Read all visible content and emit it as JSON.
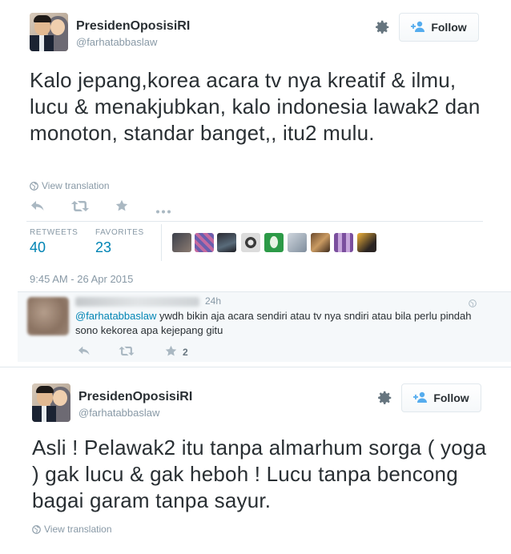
{
  "tweets": [
    {
      "display_name": "PresidenOposisiRI",
      "handle": "@farhatabbaslaw",
      "follow_label": "Follow",
      "text": "Kalo jepang,korea acara tv nya kreatif & ilmu, lucu & menakjubkan, kalo indonesia lawak2 dan monoton, standar banget,, itu2 mulu.",
      "view_translation": "View translation",
      "stats": {
        "retweets_label": "RETWEETS",
        "retweets_value": "40",
        "favorites_label": "FAVORITES",
        "favorites_value": "23"
      },
      "timestamp": "9:45 AM - 26 Apr 2015",
      "reply": {
        "time": "24h",
        "mention": "@farhatabbaslaw",
        "text": " ywdh bikin aja acara sendiri atau tv nya sndiri atau bila perlu pindah sono kekorea apa kejepang gitu",
        "favorite_count": "2"
      }
    },
    {
      "display_name": "PresidenOposisiRI",
      "handle": "@farhatabbaslaw",
      "follow_label": "Follow",
      "text": "Asli ! Pelawak2 itu tanpa almarhum sorga ( yoga ) gak lucu & gak heboh ! Lucu tanpa bencong bagai garam tanpa sayur.",
      "view_translation": "View translation"
    }
  ],
  "icons": {
    "gear": "gear-icon",
    "follow": "add-user-icon",
    "reply": "reply-icon",
    "retweet": "retweet-icon",
    "favorite": "star-icon",
    "more": "more-icon",
    "globe": "globe-icon"
  },
  "colors": {
    "link": "#0084b4",
    "muted": "#8899a6",
    "icon": "#aab8c2",
    "text": "#292f33",
    "border": "#e1e8ed"
  }
}
